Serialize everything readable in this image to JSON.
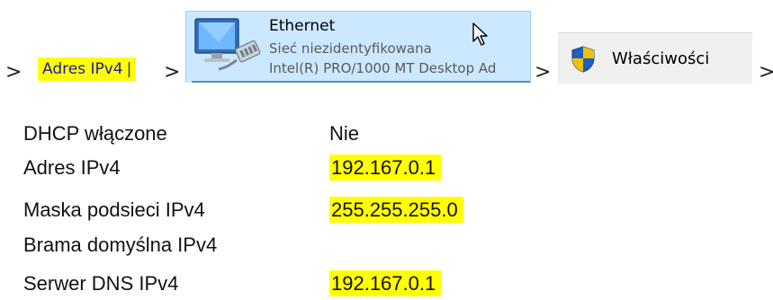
{
  "breadcrumb": {
    "separator": ">",
    "search_term": "Adres IPv4",
    "search_caret": "|",
    "ethernet": {
      "title": "Ethernet",
      "status": "Sieć niezidentyfikowana",
      "adapter": "Intel(R) PRO/1000 MT Desktop Ad"
    },
    "properties_label": "Właściwości"
  },
  "details": [
    {
      "label": "DHCP włączone",
      "value": "Nie",
      "highlight": false
    },
    {
      "label": "Adres IPv4",
      "value": "192.167.0.1",
      "highlight": true
    },
    {
      "label": "Maska podsieci IPv4",
      "value": "255.255.255.0",
      "highlight": true
    },
    {
      "label": "Brama domyślna IPv4",
      "value": "",
      "highlight": false
    },
    {
      "label": "Serwer DNS IPv4",
      "value": "192.167.0.1",
      "highlight": true
    }
  ],
  "colors": {
    "highlight": "#ffff00",
    "tile_selected": "#cce8ff",
    "link_text": "#1a1aa8"
  }
}
